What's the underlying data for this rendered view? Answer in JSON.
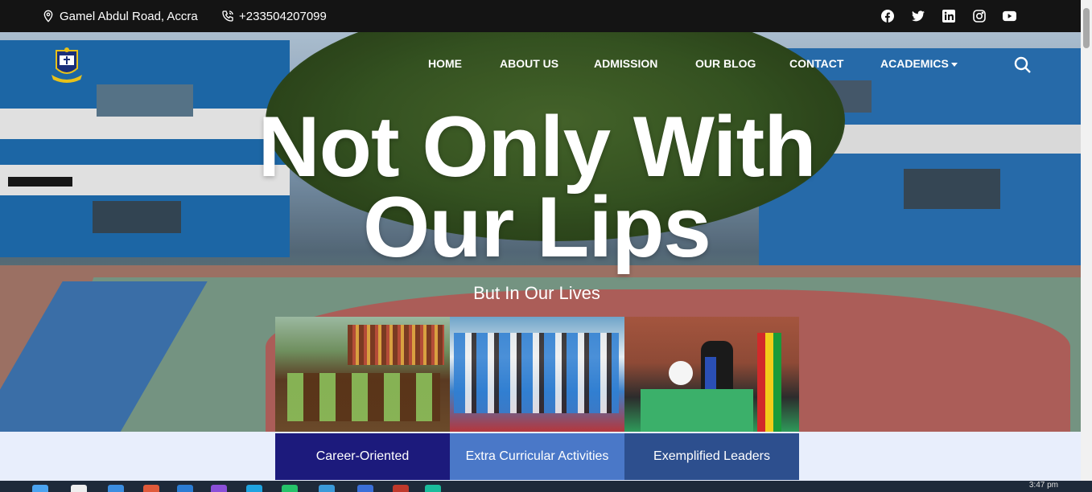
{
  "topbar": {
    "address": "Gamel Abdul Road, Accra",
    "phone": "+233504207099",
    "social_icons": [
      "facebook-icon",
      "twitter-icon",
      "linkedin-icon",
      "instagram-icon",
      "youtube-icon"
    ]
  },
  "nav": {
    "items": [
      {
        "label": "HOME"
      },
      {
        "label": "ABOUT US"
      },
      {
        "label": "ADMISSION"
      },
      {
        "label": "OUR BLOG"
      },
      {
        "label": "CONTACT"
      },
      {
        "label": "ACADEMICS"
      }
    ]
  },
  "hero": {
    "headline_line1": "Not Only With",
    "headline_line2": "Our Lips",
    "subheadline": "But In Our Lives"
  },
  "features": [
    {
      "label": "Career-Oriented",
      "color": "#1c1a7c"
    },
    {
      "label": "Extra Curricular Activities",
      "color": "#4a78c8"
    },
    {
      "label": "Exemplified Leaders",
      "color": "#2d4f8e"
    }
  ],
  "taskbar": {
    "clock": "3:47 pm"
  },
  "colors": {
    "topbar": "#141414",
    "below_hero": "#e8eefc"
  }
}
